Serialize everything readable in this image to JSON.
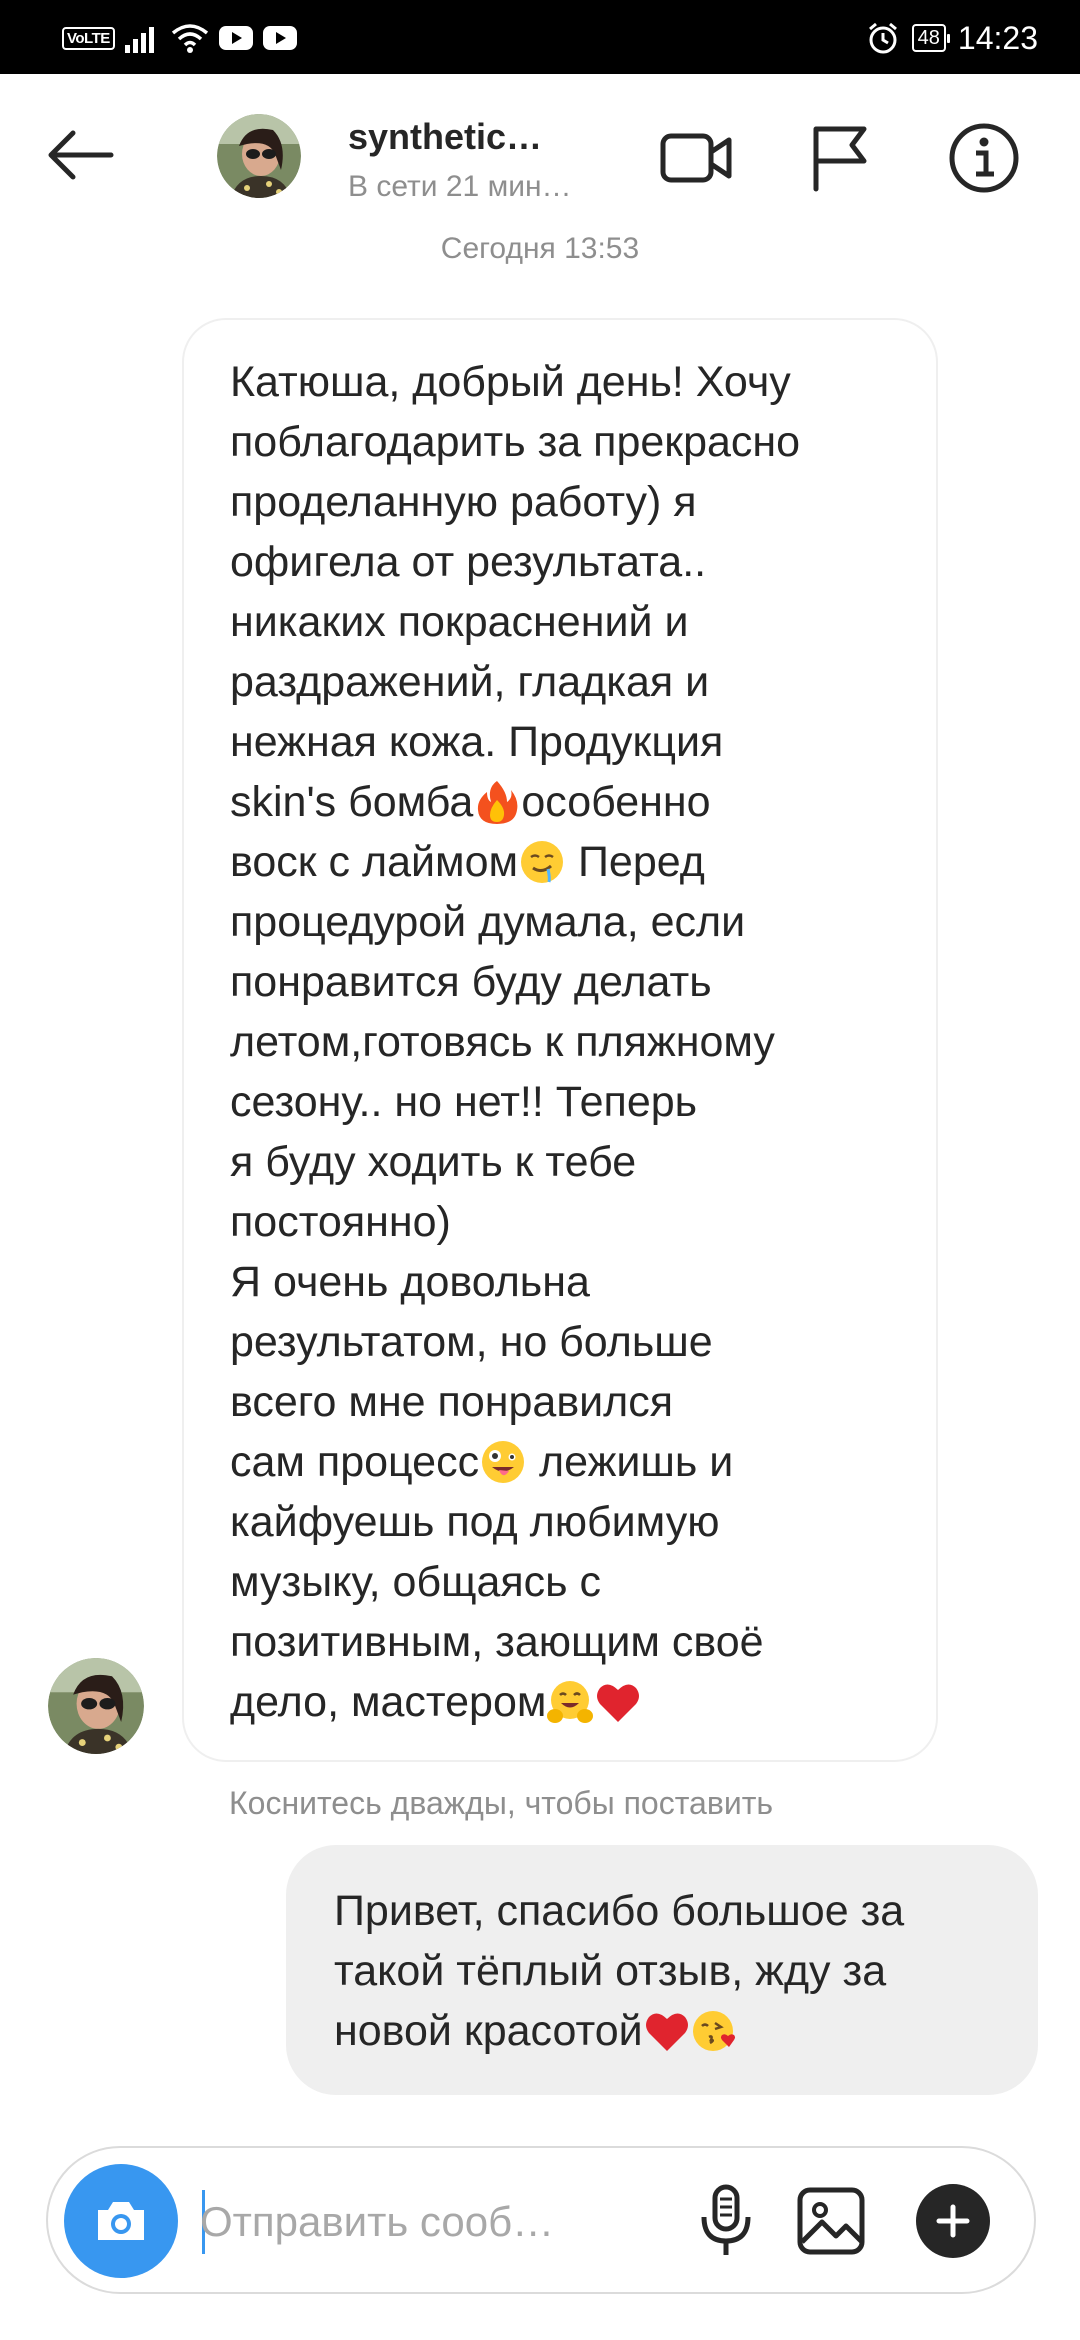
{
  "status_bar": {
    "network_label": "VoLTE",
    "battery": "48",
    "time": "14:23"
  },
  "header": {
    "contact_name": "synthetic…",
    "contact_status": "В сети 21 мин…"
  },
  "conversation": {
    "timestamp": "Сегодня 13:53",
    "incoming": {
      "lines": [
        {
          "text": "Катюша, добрый день! Хочу"
        },
        {
          "text": "поблагодарить за прекрасно"
        },
        {
          "text": "проделанную работу) я"
        },
        {
          "text": "офигела от результата.."
        },
        {
          "text": "никаких покраснений и"
        },
        {
          "text": "раздражений, гладкая и"
        },
        {
          "text": "нежная кожа. Продукция"
        },
        {
          "text": "skin's бомба",
          "emoji": "fire-emoji",
          "after": "особенно"
        },
        {
          "text": "воск с лаймом",
          "emoji": "drooling-face-emoji",
          "after": " Перед"
        },
        {
          "text": "процедурой думала, если"
        },
        {
          "text": "понравится буду делать"
        },
        {
          "text": "летом,готовясь к пляжному"
        },
        {
          "text": "сезону.. но нет!! Теперь"
        },
        {
          "text": "я буду ходить к тебе"
        },
        {
          "text": "постоянно)"
        },
        {
          "text": "Я очень довольна"
        },
        {
          "text": "результатом, но больше"
        },
        {
          "text": "всего мне понравился"
        },
        {
          "text": "сам процесс",
          "emoji": "zany-face-emoji",
          "after": " лежишь и"
        },
        {
          "text": "кайфуешь под любимую"
        },
        {
          "text": "музыку, общаясь с"
        },
        {
          "text": "позитивным, зающим своё"
        },
        {
          "text": "дело, мастером",
          "emoji": "hugging-face-emoji",
          "emoji2": "red-heart-emoji",
          "after": ""
        }
      ]
    },
    "reaction_hint": "Коснитесь дважды, чтобы поставить",
    "outgoing": {
      "lines": [
        {
          "text": "Привет, спасибо большое за"
        },
        {
          "text": "такой тёплый отзыв, жду за"
        },
        {
          "text": "новой красотой",
          "emoji": "red-heart-emoji",
          "emoji2": "face-blowing-kiss-emoji",
          "after": ""
        }
      ]
    }
  },
  "composer": {
    "placeholder": "Отправить сооб…"
  },
  "colors": {
    "accent": "#3897f0",
    "bubble_outgoing": "#efefef",
    "secondary_text": "#8e8e8e"
  }
}
